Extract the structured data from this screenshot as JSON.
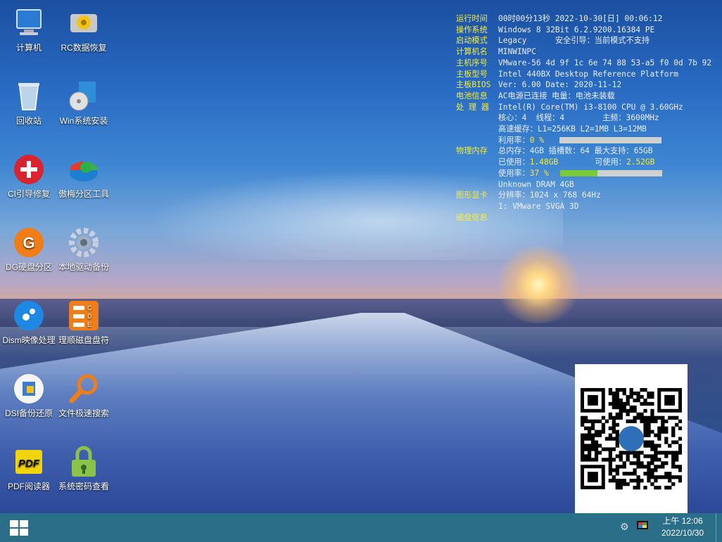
{
  "desktop_icons": [
    {
      "label": "计算机",
      "icon": "computer-icon"
    },
    {
      "label": "RC数据恢复",
      "icon": "disk-recovery-icon"
    },
    {
      "label": "回收站",
      "icon": "recycle-bin-icon"
    },
    {
      "label": "Win系统安装",
      "icon": "win-install-icon"
    },
    {
      "label": "CI引导修复",
      "icon": "boot-repair-icon"
    },
    {
      "label": "傲梅分区工具",
      "icon": "partition-tool-icon"
    },
    {
      "label": "DG硬盘分区",
      "icon": "diskgenius-icon"
    },
    {
      "label": "本地驱动备份",
      "icon": "driver-backup-icon"
    },
    {
      "label": "Dism映像处理",
      "icon": "dism-icon"
    },
    {
      "label": "理顺磁盘盘符",
      "icon": "drive-letter-icon"
    },
    {
      "label": "DSI备份还原",
      "icon": "backup-restore-icon"
    },
    {
      "label": "文件极速搜索",
      "icon": "file-search-icon"
    },
    {
      "label": "PDF阅读器",
      "icon": "pdf-reader-icon"
    },
    {
      "label": "系统密码查看",
      "icon": "password-lock-icon"
    }
  ],
  "sysinfo": {
    "runtime_k": "运行时间",
    "runtime_v": "00时00分13秒 2022-10-30[日] 00:06:12",
    "os_k": "操作系统",
    "os_v": "Windows 8 32Bit 6.2.9200.16384 PE",
    "boot_k": "启动模式",
    "boot_v": "Legacy      安全引导：当前模式不支持",
    "pc_k": "计算机名",
    "pc_v": "MINWINPC",
    "serial_k": "主机序号",
    "serial_v": "VMware-56 4d 9f 1c 6e 74 88 53-a5 f0 0d 7b 92",
    "board_k": "主板型号",
    "board_v": "Intel 440BX Desktop Reference Platform",
    "bios_k": "主板BIOS",
    "bios_v": "Ver: 6.00  Date: 2020-11-12",
    "battery_k": "电池信息",
    "battery_v": "AC电源已连接 电量：电池未装载",
    "cpu_k": "处 理 器",
    "cpu_v": "Intel(R) Core(TM) i3-8100 CPU @ 3.60GHz",
    "cpu_cores": "核心：4  线程：4        主频：3600MHz",
    "cpu_cache": "高速缓存：L1=256KB L2=1MB L3=12MB",
    "cpu_usage_label": "利用率：",
    "cpu_usage_value": "0 %",
    "cpu_usage_fraction": 0.0,
    "mem_k": "物理内存",
    "mem_v": "总内存：4GB 插槽数：64 最大支持：65GB",
    "mem_used_label": "已使用：",
    "mem_used_value": "1.48GB",
    "mem_free_label": "可使用：",
    "mem_free_value": "2.52GB",
    "mem_usage_label": "使用率：",
    "mem_usage_value": "37 %",
    "mem_usage_fraction": 0.37,
    "mem_module": "Unknown DRAM 4GB",
    "gpu_k": "图形显卡",
    "gpu_v": "分辨率：1024 x 768 64Hz",
    "gpu_name": "1: VMware SVGA 3D",
    "disk_k": "磁盘信息"
  },
  "taskbar": {
    "time": "上午 12:06",
    "date": "2022/10/30",
    "start_icon": "windows-start-icon",
    "tray_icons": [
      "settings-gear-icon",
      "monitor-icon"
    ]
  },
  "colors": {
    "info_key": "#f5ec3c",
    "taskbar": "#2a6f87",
    "usage_bar": "#7ac93a"
  }
}
